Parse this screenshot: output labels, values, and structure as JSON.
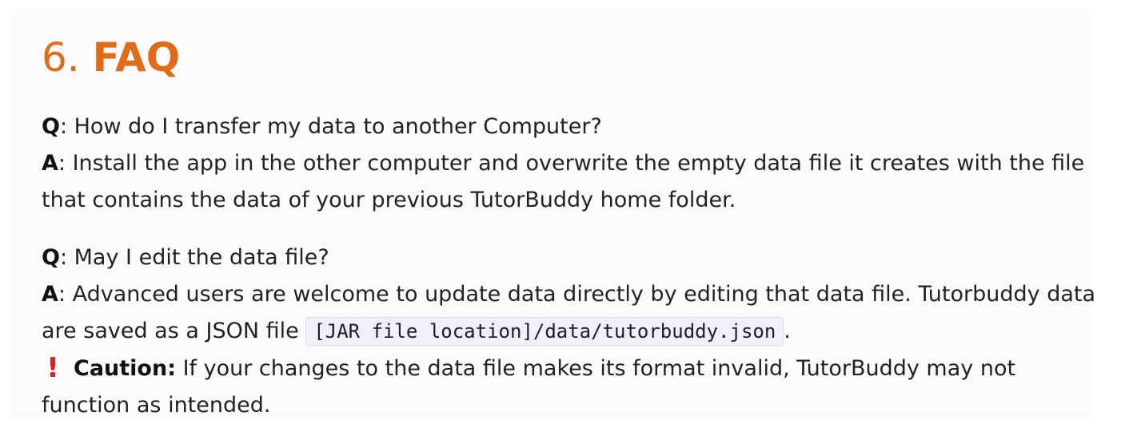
{
  "section": {
    "number": "6.",
    "title": "FAQ"
  },
  "faq": [
    {
      "q_key": "Q",
      "question": ": How do I transfer my data to another Computer?",
      "a_key": "A",
      "answer_line1": ": Install the app in the other computer and overwrite the empty data file it creates with the file",
      "answer_line2": "that contains the data of your previous TutorBuddy home folder."
    },
    {
      "q_key": "Q",
      "question": ": May I edit the data file?",
      "a_key": "A",
      "answer_line1": ": Advanced users are welcome to update data directly by editing that data file. Tutorbuddy data",
      "answer_line2_prefix": "are saved as a JSON file ",
      "code_path": "[JAR file location]/data/tutorbuddy.json",
      "answer_line2_suffix": ".",
      "caution": {
        "icon": "exclamation-icon",
        "icon_glyph": "!",
        "icon_color": "#e21c1c",
        "label": "Caution:",
        "text_line1": " If your changes to the data file makes its format invalid, TutorBuddy may not",
        "text_line2": "function as intended."
      }
    }
  ],
  "colors": {
    "heading": "#e06c17",
    "panel_background": "#fbfbfd",
    "code_background": "#eff0fa"
  }
}
